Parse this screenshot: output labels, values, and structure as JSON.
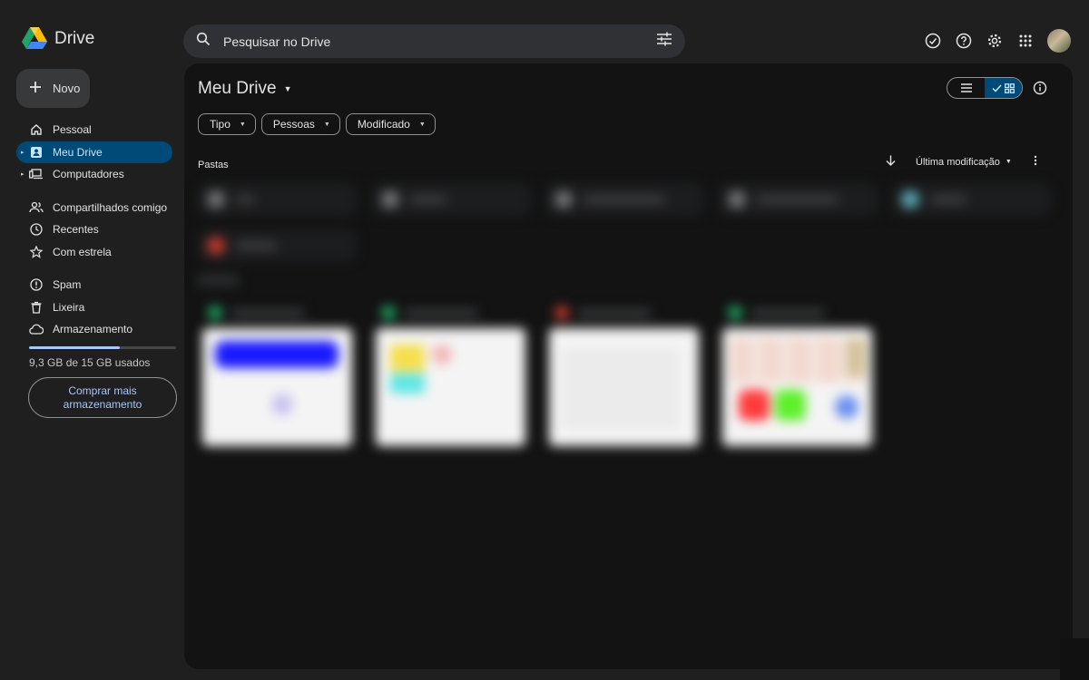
{
  "app": {
    "name": "Drive"
  },
  "search": {
    "placeholder": "Pesquisar no Drive"
  },
  "new_button": {
    "label": "Novo"
  },
  "sidebar": {
    "items": [
      {
        "label": "Pessoal",
        "icon": "home-icon"
      },
      {
        "label": "Meu Drive",
        "icon": "my-drive-icon",
        "active": true
      },
      {
        "label": "Computadores",
        "icon": "computer-icon"
      },
      {
        "label": "Compartilhados comigo",
        "icon": "people-icon"
      },
      {
        "label": "Recentes",
        "icon": "clock-icon"
      },
      {
        "label": "Com estrela",
        "icon": "star-icon"
      },
      {
        "label": "Spam",
        "icon": "spam-icon"
      },
      {
        "label": "Lixeira",
        "icon": "trash-icon"
      },
      {
        "label": "Armazenamento",
        "icon": "cloud-icon"
      }
    ]
  },
  "storage": {
    "used_text": "9,3 GB de 15 GB usados",
    "used_fraction": 0.62,
    "buy_label": "Comprar mais armazenamento"
  },
  "main": {
    "title": "Meu Drive",
    "filters": [
      "Tipo",
      "Pessoas",
      "Modificado"
    ],
    "section_folders": "Pastas",
    "sort_label": "Última modificação"
  },
  "colors": {
    "background": "#1f1f1f",
    "panel": "#131313",
    "active": "#004a77",
    "accent": "#a8c7fa"
  }
}
